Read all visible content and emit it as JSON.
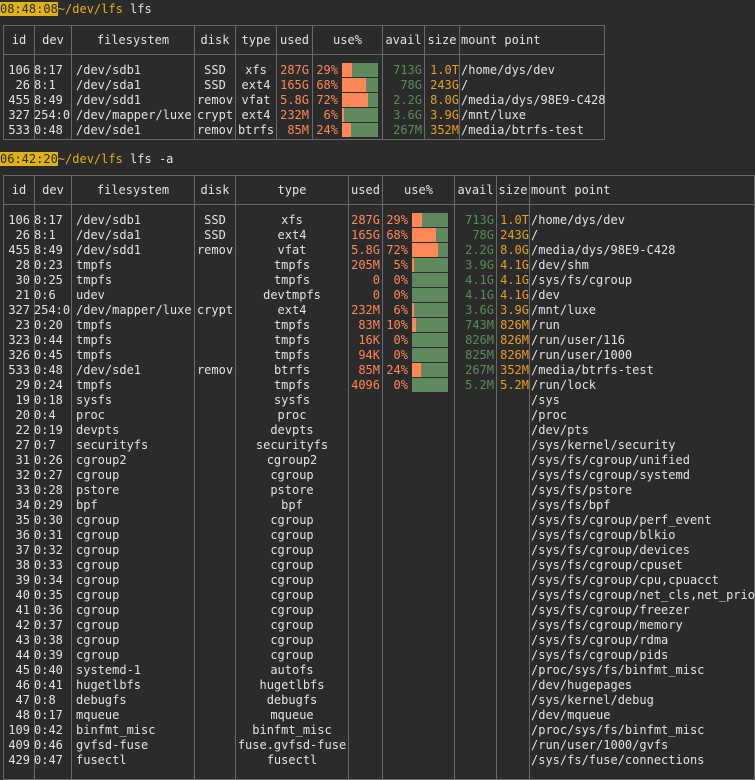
{
  "prompt1": {
    "time": "08:48:08",
    "path": "~/dev/lfs",
    "command": " lfs"
  },
  "prompt2": {
    "time": "06:42:20",
    "path": "~/dev/lfs",
    "command": " lfs -a"
  },
  "headers": [
    "id",
    "dev",
    "filesystem",
    "disk",
    "type",
    "used",
    "use%",
    "avail",
    "size",
    "mount point"
  ],
  "colors": {
    "used": "#ff8757",
    "avail": "#5b8b5b",
    "size": "#e8a020",
    "bar_bg": "#5f8a5f",
    "bar_fill": "#ff8757",
    "prompt_time_bg": "#e0b21a"
  },
  "table1": [
    {
      "id": "106",
      "dev": "8:17",
      "fs": "/dev/sdb1",
      "disk": "SSD",
      "type": "xfs",
      "used": "287G",
      "pct": "29%",
      "use": 0.29,
      "avail": "713G",
      "size": "1.0T",
      "mount": "/home/dys/dev"
    },
    {
      "id": "26",
      "dev": "8:1",
      "fs": "/dev/sda1",
      "disk": "SSD",
      "type": "ext4",
      "used": "165G",
      "pct": "68%",
      "use": 0.68,
      "avail": "78G",
      "size": "243G",
      "mount": "/"
    },
    {
      "id": "455",
      "dev": "8:49",
      "fs": "/dev/sdd1",
      "disk": "remov",
      "type": "vfat",
      "used": "5.8G",
      "pct": "72%",
      "use": 0.72,
      "avail": "2.2G",
      "size": "8.0G",
      "mount": "/media/dys/98E9-C428"
    },
    {
      "id": "327",
      "dev": "254:0",
      "fs": "/dev/mapper/luxe",
      "disk": "crypt",
      "type": "ext4",
      "used": "232M",
      "pct": "6%",
      "use": 0.06,
      "avail": "3.6G",
      "size": "3.9G",
      "mount": "/mnt/luxe"
    },
    {
      "id": "533",
      "dev": "0:48",
      "fs": "/dev/sde1",
      "disk": "remov",
      "type": "btrfs",
      "used": "85M",
      "pct": "24%",
      "use": 0.24,
      "avail": "267M",
      "size": "352M",
      "mount": "/media/btrfs-test"
    }
  ],
  "table2": [
    {
      "id": "106",
      "dev": "8:17",
      "fs": "/dev/sdb1",
      "disk": "SSD",
      "type": "xfs",
      "used": "287G",
      "pct": "29%",
      "use": 0.29,
      "avail": "713G",
      "size": "1.0T",
      "mount": "/home/dys/dev"
    },
    {
      "id": "26",
      "dev": "8:1",
      "fs": "/dev/sda1",
      "disk": "SSD",
      "type": "ext4",
      "used": "165G",
      "pct": "68%",
      "use": 0.68,
      "avail": "78G",
      "size": "243G",
      "mount": "/"
    },
    {
      "id": "455",
      "dev": "8:49",
      "fs": "/dev/sdd1",
      "disk": "remov",
      "type": "vfat",
      "used": "5.8G",
      "pct": "72%",
      "use": 0.72,
      "avail": "2.2G",
      "size": "8.0G",
      "mount": "/media/dys/98E9-C428"
    },
    {
      "id": "28",
      "dev": "0:23",
      "fs": "tmpfs",
      "disk": "",
      "type": "tmpfs",
      "used": "205M",
      "pct": "5%",
      "use": 0.05,
      "avail": "3.9G",
      "size": "4.1G",
      "mount": "/dev/shm"
    },
    {
      "id": "30",
      "dev": "0:25",
      "fs": "tmpfs",
      "disk": "",
      "type": "tmpfs",
      "used": "0",
      "pct": "0%",
      "use": 0,
      "avail": "4.1G",
      "size": "4.1G",
      "mount": "/sys/fs/cgroup"
    },
    {
      "id": "21",
      "dev": "0:6",
      "fs": "udev",
      "disk": "",
      "type": "devtmpfs",
      "used": "0",
      "pct": "0%",
      "use": 0,
      "avail": "4.1G",
      "size": "4.1G",
      "mount": "/dev"
    },
    {
      "id": "327",
      "dev": "254:0",
      "fs": "/dev/mapper/luxe",
      "disk": "crypt",
      "type": "ext4",
      "used": "232M",
      "pct": "6%",
      "use": 0.06,
      "avail": "3.6G",
      "size": "3.9G",
      "mount": "/mnt/luxe"
    },
    {
      "id": "23",
      "dev": "0:20",
      "fs": "tmpfs",
      "disk": "",
      "type": "tmpfs",
      "used": "83M",
      "pct": "10%",
      "use": 0.1,
      "avail": "743M",
      "size": "826M",
      "mount": "/run"
    },
    {
      "id": "323",
      "dev": "0:44",
      "fs": "tmpfs",
      "disk": "",
      "type": "tmpfs",
      "used": "16K",
      "pct": "0%",
      "use": 0,
      "avail": "826M",
      "size": "826M",
      "mount": "/run/user/116"
    },
    {
      "id": "326",
      "dev": "0:45",
      "fs": "tmpfs",
      "disk": "",
      "type": "tmpfs",
      "used": "94K",
      "pct": "0%",
      "use": 0,
      "avail": "825M",
      "size": "826M",
      "mount": "/run/user/1000"
    },
    {
      "id": "533",
      "dev": "0:48",
      "fs": "/dev/sde1",
      "disk": "remov",
      "type": "btrfs",
      "used": "85M",
      "pct": "24%",
      "use": 0.24,
      "avail": "267M",
      "size": "352M",
      "mount": "/media/btrfs-test"
    },
    {
      "id": "29",
      "dev": "0:24",
      "fs": "tmpfs",
      "disk": "",
      "type": "tmpfs",
      "used": "4096",
      "pct": "0%",
      "use": 0,
      "avail": "5.2M",
      "size": "5.2M",
      "mount": "/run/lock"
    },
    {
      "id": "19",
      "dev": "0:18",
      "fs": "sysfs",
      "disk": "",
      "type": "sysfs",
      "mount": "/sys"
    },
    {
      "id": "20",
      "dev": "0:4",
      "fs": "proc",
      "disk": "",
      "type": "proc",
      "mount": "/proc"
    },
    {
      "id": "22",
      "dev": "0:19",
      "fs": "devpts",
      "disk": "",
      "type": "devpts",
      "mount": "/dev/pts"
    },
    {
      "id": "27",
      "dev": "0:7",
      "fs": "securityfs",
      "disk": "",
      "type": "securityfs",
      "mount": "/sys/kernel/security"
    },
    {
      "id": "31",
      "dev": "0:26",
      "fs": "cgroup2",
      "disk": "",
      "type": "cgroup2",
      "mount": "/sys/fs/cgroup/unified"
    },
    {
      "id": "32",
      "dev": "0:27",
      "fs": "cgroup",
      "disk": "",
      "type": "cgroup",
      "mount": "/sys/fs/cgroup/systemd"
    },
    {
      "id": "33",
      "dev": "0:28",
      "fs": "pstore",
      "disk": "",
      "type": "pstore",
      "mount": "/sys/fs/pstore"
    },
    {
      "id": "34",
      "dev": "0:29",
      "fs": "bpf",
      "disk": "",
      "type": "bpf",
      "mount": "/sys/fs/bpf"
    },
    {
      "id": "35",
      "dev": "0:30",
      "fs": "cgroup",
      "disk": "",
      "type": "cgroup",
      "mount": "/sys/fs/cgroup/perf_event"
    },
    {
      "id": "36",
      "dev": "0:31",
      "fs": "cgroup",
      "disk": "",
      "type": "cgroup",
      "mount": "/sys/fs/cgroup/blkio"
    },
    {
      "id": "37",
      "dev": "0:32",
      "fs": "cgroup",
      "disk": "",
      "type": "cgroup",
      "mount": "/sys/fs/cgroup/devices"
    },
    {
      "id": "38",
      "dev": "0:33",
      "fs": "cgroup",
      "disk": "",
      "type": "cgroup",
      "mount": "/sys/fs/cgroup/cpuset"
    },
    {
      "id": "39",
      "dev": "0:34",
      "fs": "cgroup",
      "disk": "",
      "type": "cgroup",
      "mount": "/sys/fs/cgroup/cpu,cpuacct"
    },
    {
      "id": "40",
      "dev": "0:35",
      "fs": "cgroup",
      "disk": "",
      "type": "cgroup",
      "mount": "/sys/fs/cgroup/net_cls,net_prio"
    },
    {
      "id": "41",
      "dev": "0:36",
      "fs": "cgroup",
      "disk": "",
      "type": "cgroup",
      "mount": "/sys/fs/cgroup/freezer"
    },
    {
      "id": "42",
      "dev": "0:37",
      "fs": "cgroup",
      "disk": "",
      "type": "cgroup",
      "mount": "/sys/fs/cgroup/memory"
    },
    {
      "id": "43",
      "dev": "0:38",
      "fs": "cgroup",
      "disk": "",
      "type": "cgroup",
      "mount": "/sys/fs/cgroup/rdma"
    },
    {
      "id": "44",
      "dev": "0:39",
      "fs": "cgroup",
      "disk": "",
      "type": "cgroup",
      "mount": "/sys/fs/cgroup/pids"
    },
    {
      "id": "45",
      "dev": "0:40",
      "fs": "systemd-1",
      "disk": "",
      "type": "autofs",
      "mount": "/proc/sys/fs/binfmt_misc"
    },
    {
      "id": "46",
      "dev": "0:41",
      "fs": "hugetlbfs",
      "disk": "",
      "type": "hugetlbfs",
      "mount": "/dev/hugepages"
    },
    {
      "id": "47",
      "dev": "0:8",
      "fs": "debugfs",
      "disk": "",
      "type": "debugfs",
      "mount": "/sys/kernel/debug"
    },
    {
      "id": "48",
      "dev": "0:17",
      "fs": "mqueue",
      "disk": "",
      "type": "mqueue",
      "mount": "/dev/mqueue"
    },
    {
      "id": "109",
      "dev": "0:42",
      "fs": "binfmt_misc",
      "disk": "",
      "type": "binfmt_misc",
      "mount": "/proc/sys/fs/binfmt_misc"
    },
    {
      "id": "409",
      "dev": "0:46",
      "fs": "gvfsd-fuse",
      "disk": "",
      "type": "fuse.gvfsd-fuse",
      "mount": "/run/user/1000/gvfs"
    },
    {
      "id": "429",
      "dev": "0:47",
      "fs": "fusectl",
      "disk": "",
      "type": "fusectl",
      "mount": "/sys/fs/fuse/connections"
    }
  ]
}
